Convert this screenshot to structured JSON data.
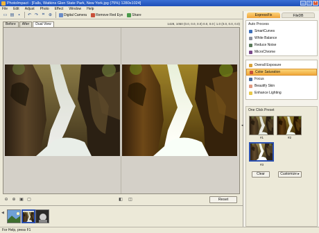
{
  "window": {
    "title": "PhotoImpact - [Falls, Watkins Glen State Park, New York.jpg (75%) 1280x1024]",
    "controls": [
      "_",
      "▫",
      "×"
    ]
  },
  "menu": [
    "File",
    "Edit",
    "Adjust",
    "Photo",
    "Effect",
    "Window",
    "Help"
  ],
  "toolbar": {
    "digital_camera": "Digital Camera",
    "remove_red_eye": "Remove Red Eye",
    "share": "Share"
  },
  "tabs": [
    "Before",
    "After",
    "Dual View"
  ],
  "info_text": "1428, 1050 (0.0, 0.0, 0.0) 0.0, 0.0 | 1.0 (0.0, 0.0, 0.0)",
  "reset_label": "Reset",
  "panel": {
    "tabs": [
      "ExpressFix",
      "FileDB"
    ],
    "auto_process": {
      "header": "Auto Process",
      "items": [
        "SmartCurves",
        "White Balance",
        "Reduce Noise",
        "MicroChrome"
      ]
    },
    "adjust_items": [
      "Overall Exposure",
      "Color Saturation",
      "Focus",
      "Beautify Skin",
      "Enhance Lighting"
    ],
    "selected_item": "Color Saturation",
    "one_click": {
      "header": "One Click Preset",
      "labels": [
        "#1",
        "#2",
        "#3"
      ],
      "clear": "Clear",
      "customize": "Customize ▸"
    }
  },
  "status": "For Help, press F1",
  "colors": {
    "title_bar": "#1d4fb8",
    "highlight": "#f0a83a",
    "selection_border": "#2a4fb0"
  }
}
